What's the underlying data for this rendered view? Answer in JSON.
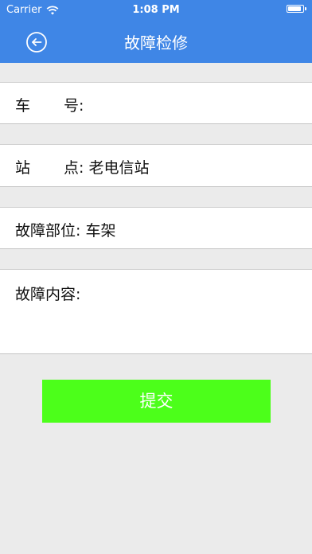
{
  "status_bar": {
    "carrier": "Carrier",
    "wifi_icon": "wifi-icon",
    "time": "1:08 PM",
    "battery_icon": "battery-icon",
    "battery_level": 0.9
  },
  "nav": {
    "back_icon": "back-arrow-circle-icon",
    "title": "故障检修"
  },
  "form": {
    "car_number": {
      "label_part1": "车",
      "label_part2": "号:",
      "value": ""
    },
    "station": {
      "label_part1": "站",
      "label_part2": "点:",
      "value": "老电信站"
    },
    "fault_location": {
      "label": "故障部位:",
      "value": "车架"
    },
    "fault_content": {
      "label": "故障内容:",
      "value": ""
    }
  },
  "submit_label": "提交",
  "colors": {
    "header": "#3f86e6",
    "background": "#ebebeb",
    "submit_button": "#4cff1a"
  }
}
